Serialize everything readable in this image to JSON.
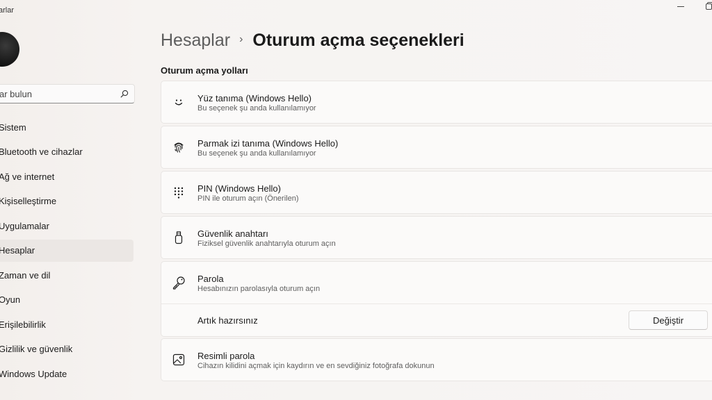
{
  "window": {
    "app_title": "arlar"
  },
  "sidebar": {
    "search_placeholder": "ar bulun",
    "items": [
      {
        "label": "Sistem"
      },
      {
        "label": "Bluetooth ve cihazlar"
      },
      {
        "label": "Ağ ve internet"
      },
      {
        "label": "Kişiselleştirme"
      },
      {
        "label": "Uygulamalar"
      },
      {
        "label": "Hesaplar",
        "active": true
      },
      {
        "label": "Zaman ve dil"
      },
      {
        "label": "Oyun"
      },
      {
        "label": "Erişilebilirlik"
      },
      {
        "label": "Gizlilik ve güvenlik"
      },
      {
        "label": "Windows Update"
      }
    ]
  },
  "header": {
    "parent": "Hesaplar",
    "separator": "›",
    "current": "Oturum açma seçenekleri"
  },
  "section": {
    "title": "Oturum açma yolları"
  },
  "options": [
    {
      "icon": "smile-face-icon",
      "title": "Yüz tanıma (Windows Hello)",
      "desc": "Bu seçenek şu anda kullanılamıyor"
    },
    {
      "icon": "fingerprint-icon",
      "title": "Parmak izi tanıma (Windows Hello)",
      "desc": "Bu seçenek şu anda kullanılamıyor"
    },
    {
      "icon": "keypad-icon",
      "title": "PIN (Windows Hello)",
      "desc": "PIN ile oturum açın (Önerilen)"
    },
    {
      "icon": "usb-key-icon",
      "title": "Güvenlik anahtarı",
      "desc": "Fiziksel güvenlik anahtarıyla oturum açın"
    },
    {
      "icon": "key-icon",
      "title": "Parola",
      "desc": "Hesabınızın parolasıyla oturum açın",
      "subrow": {
        "label": "Artık hazırsınız",
        "button": "Değiştir"
      }
    },
    {
      "icon": "picture-icon",
      "title": "Resimli parola",
      "desc": "Cihazın kilidini açmak için kaydırın ve en sevdiğiniz fotoğrafa dokunun"
    }
  ],
  "colors": {
    "background": "#f6f3f1",
    "card": "#fbfaf9",
    "nav_active": "#ebe7e4",
    "text_primary": "#1b1b1b",
    "text_secondary": "#5e5e5e"
  }
}
